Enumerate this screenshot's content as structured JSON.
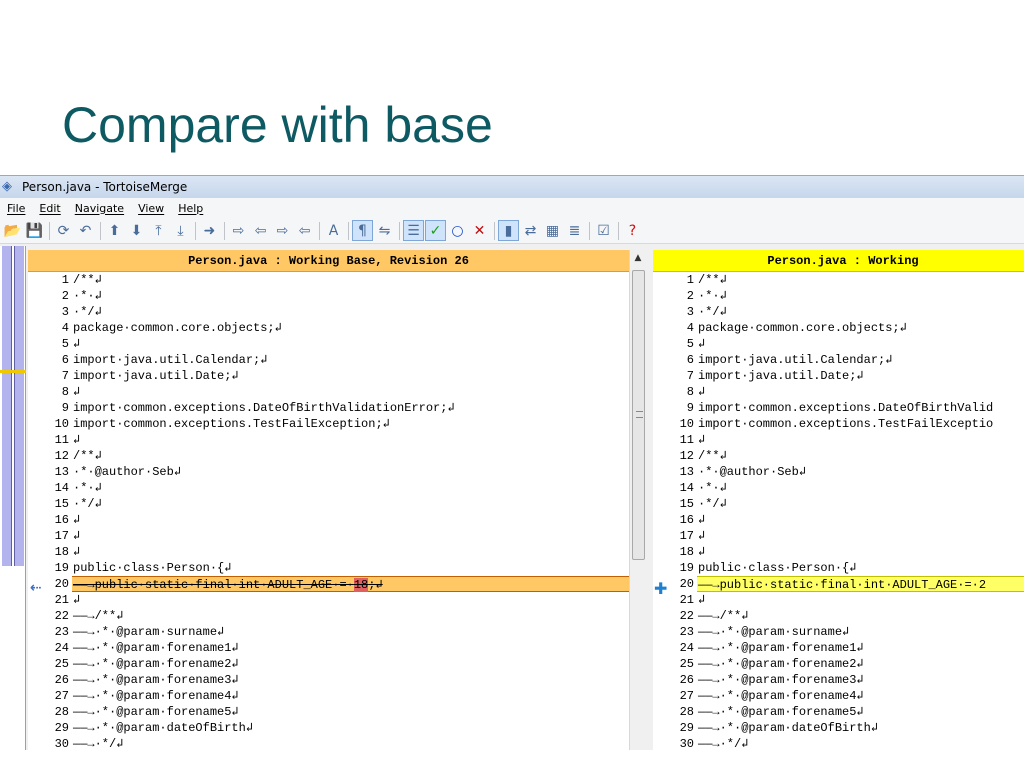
{
  "slide": {
    "title": "Compare with base"
  },
  "window": {
    "title": "Person.java - TortoiseMerge"
  },
  "menu": [
    "File",
    "Edit",
    "Navigate",
    "View",
    "Help"
  ],
  "toolbar": {
    "buttons": [
      {
        "name": "open-icon",
        "glyph": "📂"
      },
      {
        "name": "save-icon",
        "glyph": "💾"
      },
      {
        "name": "sep"
      },
      {
        "name": "reload-icon",
        "glyph": "⟳"
      },
      {
        "name": "undo-icon",
        "glyph": "↶"
      },
      {
        "name": "sep"
      },
      {
        "name": "prev-difference-icon",
        "glyph": "⬆"
      },
      {
        "name": "next-difference-icon",
        "glyph": "⬇"
      },
      {
        "name": "first-difference-icon",
        "glyph": "⤒"
      },
      {
        "name": "last-difference-icon",
        "glyph": "⤓"
      },
      {
        "name": "sep"
      },
      {
        "name": "go-next-icon",
        "glyph": "➜"
      },
      {
        "name": "sep"
      },
      {
        "name": "next-conflict-icon",
        "glyph": "⇨"
      },
      {
        "name": "prev-conflict-icon",
        "glyph": "⇦"
      },
      {
        "name": "next-inline-icon",
        "glyph": "⇨"
      },
      {
        "name": "prev-inline-icon",
        "glyph": "⇦"
      },
      {
        "name": "sep"
      },
      {
        "name": "find-icon",
        "glyph": "A"
      },
      {
        "name": "sep"
      },
      {
        "name": "whitespace-icon",
        "glyph": "¶",
        "pressed": true
      },
      {
        "name": "wrap-icon",
        "glyph": "⇋"
      },
      {
        "name": "sep"
      },
      {
        "name": "linediff-icon",
        "glyph": "☰",
        "pressed": true
      },
      {
        "name": "use-theirs-icon",
        "glyph": "✓",
        "pressed": true,
        "color": "#1a9e1a"
      },
      {
        "name": "use-mine-icon",
        "glyph": "○",
        "color": "#1a4fd0"
      },
      {
        "name": "mark-resolved-icon",
        "glyph": "✕",
        "color": "#c01010"
      },
      {
        "name": "sep"
      },
      {
        "name": "oneway-view-icon",
        "glyph": "▮",
        "pressed": true
      },
      {
        "name": "twoway-view-icon",
        "glyph": "⇄"
      },
      {
        "name": "threeway-view-icon",
        "glyph": "▦"
      },
      {
        "name": "sidebyside-icon",
        "glyph": "≣"
      },
      {
        "name": "sep"
      },
      {
        "name": "patch-icon",
        "glyph": "☑"
      },
      {
        "name": "sep"
      },
      {
        "name": "help-icon",
        "glyph": "?",
        "color": "#d01010"
      }
    ]
  },
  "left_pane": {
    "header": "Person.java : Working Base, Revision 26",
    "lines": [
      {
        "n": "1",
        "text": "/**↲"
      },
      {
        "n": "2",
        "text": "·*·↲"
      },
      {
        "n": "3",
        "text": "·*/↲"
      },
      {
        "n": "4",
        "text": "package·common.core.objects;↲"
      },
      {
        "n": "5",
        "text": "↲"
      },
      {
        "n": "6",
        "text": "import·java.util.Calendar;↲"
      },
      {
        "n": "7",
        "text": "import·java.util.Date;↲"
      },
      {
        "n": "8",
        "text": "↲"
      },
      {
        "n": "9",
        "text": "import·common.exceptions.DateOfBirthValidationError;↲"
      },
      {
        "n": "10",
        "text": "import·common.exceptions.TestFailException;↲"
      },
      {
        "n": "11",
        "text": "↲"
      },
      {
        "n": "12",
        "text": "/**↲"
      },
      {
        "n": "13",
        "text": "·*·@author·Seb↲"
      },
      {
        "n": "14",
        "text": "·*·↲"
      },
      {
        "n": "15",
        "text": "·*/↲"
      },
      {
        "n": "16",
        "text": "↲"
      },
      {
        "n": "17",
        "text": "↲"
      },
      {
        "n": "18",
        "text": "↲"
      },
      {
        "n": "19",
        "text": "public·class·Person·{↲"
      },
      {
        "n": "20",
        "text_pre": "——→public·static·final·int·ADULT_AGE·=·",
        "text_hl": "18",
        "text_post": ";↲",
        "state": "removed"
      },
      {
        "n": "21",
        "text": "↲"
      },
      {
        "n": "22",
        "text": "——→/**↲"
      },
      {
        "n": "23",
        "text": "——→·*·@param·surname↲"
      },
      {
        "n": "24",
        "text": "——→·*·@param·forename1↲"
      },
      {
        "n": "25",
        "text": "——→·*·@param·forename2↲"
      },
      {
        "n": "26",
        "text": "——→·*·@param·forename3↲"
      },
      {
        "n": "27",
        "text": "——→·*·@param·forename4↲"
      },
      {
        "n": "28",
        "text": "——→·*·@param·forename5↲"
      },
      {
        "n": "29",
        "text": "——→·*·@param·dateOfBirth↲"
      },
      {
        "n": "30",
        "text": "——→·*/↲"
      }
    ]
  },
  "right_pane": {
    "header": "Person.java : Working",
    "lines": [
      {
        "n": "1",
        "text": "/**↲"
      },
      {
        "n": "2",
        "text": "·*·↲"
      },
      {
        "n": "3",
        "text": "·*/↲"
      },
      {
        "n": "4",
        "text": "package·common.core.objects;↲"
      },
      {
        "n": "5",
        "text": "↲"
      },
      {
        "n": "6",
        "text": "import·java.util.Calendar;↲"
      },
      {
        "n": "7",
        "text": "import·java.util.Date;↲"
      },
      {
        "n": "8",
        "text": "↲"
      },
      {
        "n": "9",
        "text": "import·common.exceptions.DateOfBirthValid"
      },
      {
        "n": "10",
        "text": "import·common.exceptions.TestFailExceptio"
      },
      {
        "n": "11",
        "text": "↲"
      },
      {
        "n": "12",
        "text": "/**↲"
      },
      {
        "n": "13",
        "text": "·*·@author·Seb↲"
      },
      {
        "n": "14",
        "text": "·*·↲"
      },
      {
        "n": "15",
        "text": "·*/↲"
      },
      {
        "n": "16",
        "text": "↲"
      },
      {
        "n": "17",
        "text": "↲"
      },
      {
        "n": "18",
        "text": "↲"
      },
      {
        "n": "19",
        "text": "public·class·Person·{↲"
      },
      {
        "n": "20",
        "text": "——→public·static·final·int·ADULT_AGE·=·2",
        "state": "added"
      },
      {
        "n": "21",
        "text": "↲"
      },
      {
        "n": "22",
        "text": "——→/**↲"
      },
      {
        "n": "23",
        "text": "——→·*·@param·surname↲"
      },
      {
        "n": "24",
        "text": "——→·*·@param·forename1↲"
      },
      {
        "n": "25",
        "text": "——→·*·@param·forename2↲"
      },
      {
        "n": "26",
        "text": "——→·*·@param·forename3↲"
      },
      {
        "n": "27",
        "text": "——→·*·@param·forename4↲"
      },
      {
        "n": "28",
        "text": "——→·*·@param·forename5↲"
      },
      {
        "n": "29",
        "text": "——→·*·@param·dateOfBirth↲"
      },
      {
        "n": "30",
        "text": "——→·*/↲"
      }
    ]
  },
  "markers": {
    "left": "⇠",
    "right": "✚"
  },
  "scrollbar": {
    "up_arrow": "▲"
  }
}
